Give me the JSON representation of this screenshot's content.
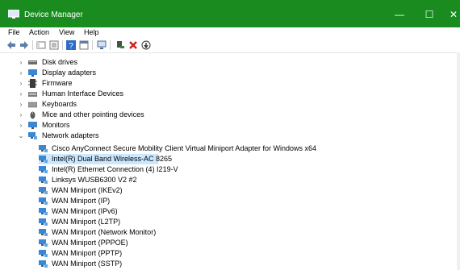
{
  "window": {
    "title": "Device Manager",
    "minimize_glyph": "—",
    "maximize_glyph": "☐",
    "close_glyph": "✕",
    "titlebar_color": "#1a8c1f"
  },
  "menu": {
    "items": [
      "File",
      "Action",
      "View",
      "Help"
    ]
  },
  "toolbar": {
    "icons": [
      "back-icon",
      "forward-icon",
      "show-hide-tree-icon",
      "properties-icon",
      "help-icon",
      "view-icon",
      "scan-hardware-icon",
      "enable-device-icon",
      "uninstall-icon",
      "update-driver-icon"
    ],
    "accent_remove": "#d21f1f",
    "accent_enable": "#2c8c2c"
  },
  "tree": {
    "categories": [
      {
        "label": "Disk drives",
        "icon": "disk-drive-icon",
        "expanded": false
      },
      {
        "label": "Display adapters",
        "icon": "display-adapter-icon",
        "expanded": false
      },
      {
        "label": "Firmware",
        "icon": "firmware-icon",
        "expanded": false
      },
      {
        "label": "Human Interface Devices",
        "icon": "hid-icon",
        "expanded": false
      },
      {
        "label": "Keyboards",
        "icon": "keyboard-icon",
        "expanded": false
      },
      {
        "label": "Mice and other pointing devices",
        "icon": "mouse-icon",
        "expanded": false
      },
      {
        "label": "Monitors",
        "icon": "monitor-icon",
        "expanded": false
      },
      {
        "label": "Network adapters",
        "icon": "network-adapter-icon",
        "expanded": true
      }
    ],
    "network_adapters": [
      "Cisco AnyConnect Secure Mobility Client Virtual Miniport Adapter for Windows x64",
      "Intel(R) Dual Band Wireless-AC 8265",
      "Intel(R) Ethernet Connection (4) I219-V",
      "Linksys WUSB6300 V2 #2",
      "WAN Miniport (IKEv2)",
      "WAN Miniport (IP)",
      "WAN Miniport (IPv6)",
      "WAN Miniport (L2TP)",
      "WAN Miniport (Network Monitor)",
      "WAN Miniport (PPPOE)",
      "WAN Miniport (PPTP)",
      "WAN Miniport (SSTP)"
    ],
    "selected_adapter": "Intel(R) Dual Band Wireless-AC 8265",
    "selection_color": "#cce8ff"
  }
}
